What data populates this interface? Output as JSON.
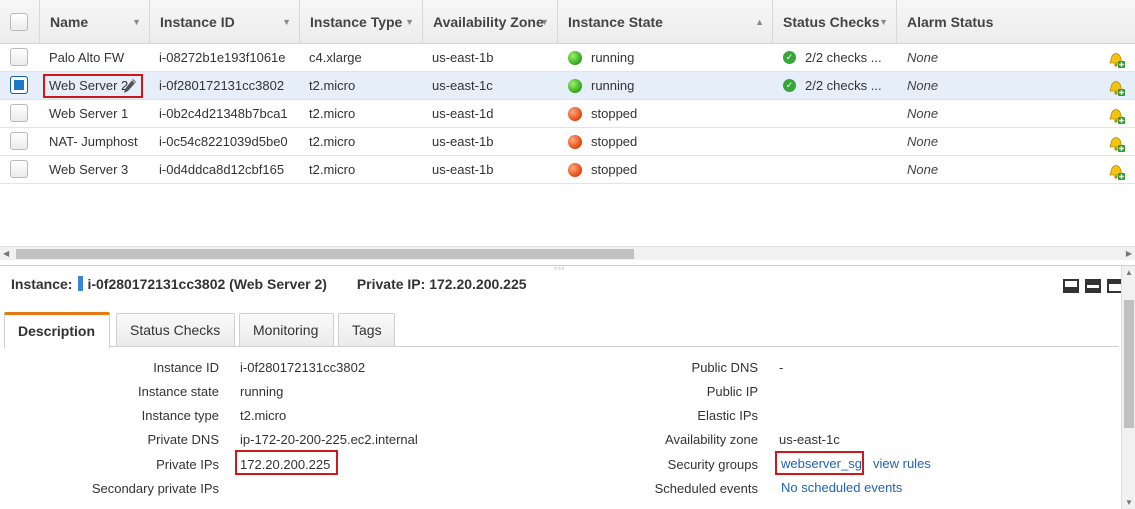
{
  "table": {
    "columns": {
      "name": "Name",
      "instance_id": "Instance ID",
      "instance_type": "Instance Type",
      "availability_zone": "Availability Zone",
      "instance_state": "Instance State",
      "status_checks": "Status Checks",
      "alarm_status": "Alarm Status"
    },
    "rows": [
      {
        "name": "Palo Alto FW",
        "id": "i-08272b1e193f1061e",
        "type": "c4.xlarge",
        "az": "us-east-1b",
        "state": "running",
        "checks": "2/2 checks ...",
        "alarm": "None"
      },
      {
        "name": "Web Server 2",
        "id": "i-0f280172131cc3802",
        "type": "t2.micro",
        "az": "us-east-1c",
        "state": "running",
        "checks": "2/2 checks ...",
        "alarm": "None"
      },
      {
        "name": "Web Server 1",
        "id": "i-0b2c4d21348b7bca1",
        "type": "t2.micro",
        "az": "us-east-1d",
        "state": "stopped",
        "checks": "",
        "alarm": "None"
      },
      {
        "name": "NAT- Jumphost",
        "id": "i-0c54c8221039d5be0",
        "type": "t2.micro",
        "az": "us-east-1b",
        "state": "stopped",
        "checks": "",
        "alarm": "None"
      },
      {
        "name": "Web Server 3",
        "id": "i-0d4ddca8d12cbf165",
        "type": "t2.micro",
        "az": "us-east-1b",
        "state": "stopped",
        "checks": "",
        "alarm": "None"
      }
    ],
    "selected_row_index": 1
  },
  "detail": {
    "instance_label": "Instance:",
    "instance_value": "i-0f280172131cc3802 (Web Server 2)",
    "private_ip_label": "Private IP:",
    "private_ip_value": "172.20.200.225",
    "tabs": [
      "Description",
      "Status Checks",
      "Monitoring",
      "Tags"
    ],
    "left_fields": [
      {
        "label": "Instance ID",
        "value": "i-0f280172131cc3802"
      },
      {
        "label": "Instance state",
        "value": "running"
      },
      {
        "label": "Instance type",
        "value": "t2.micro"
      },
      {
        "label": "Private DNS",
        "value": "ip-172-20-200-225.ec2.internal"
      },
      {
        "label": "Private IPs",
        "value": "172.20.200.225"
      },
      {
        "label": "Secondary private IPs",
        "value": ""
      }
    ],
    "right_fields": [
      {
        "label": "Public DNS",
        "value": "-"
      },
      {
        "label": "Public IP",
        "value": ""
      },
      {
        "label": "Elastic IPs",
        "value": ""
      },
      {
        "label": "Availability zone",
        "value": "us-east-1c"
      },
      {
        "label": "Security groups",
        "value": "webserver_sg",
        "extra": "view rules"
      },
      {
        "label": "Scheduled events",
        "value": "No scheduled events"
      }
    ]
  },
  "colors": {
    "running": "#2fa51c",
    "stopped": "#e3430f",
    "selected_row": "#e6eef9",
    "highlight": "#d0181b",
    "link": "#1f62bd",
    "active_tab": "#e47911"
  },
  "icons": {
    "alarm": "bell-add-icon",
    "edit": "pencil-icon",
    "check": "check-circle-icon"
  }
}
